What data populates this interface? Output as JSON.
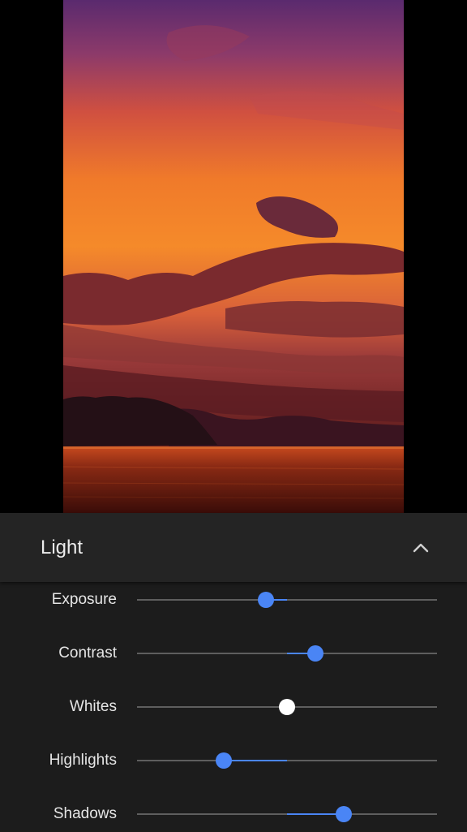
{
  "colors": {
    "accent": "#4a85f5",
    "panel_bg": "#1c1c1c",
    "header_bg": "#242424",
    "track": "#5e5e5e",
    "neutral_thumb": "#ffffff"
  },
  "panel": {
    "title": "Light",
    "collapse_icon": "chevron-up-icon"
  },
  "adjustments": [
    {
      "label": "Exposure",
      "value": -0.14,
      "neutral": false
    },
    {
      "label": "Contrast",
      "value": 0.19,
      "neutral": false
    },
    {
      "label": "Whites",
      "value": 0.0,
      "neutral": true
    },
    {
      "label": "Highlights",
      "value": -0.42,
      "neutral": false
    },
    {
      "label": "Shadows",
      "value": 0.38,
      "neutral": false
    }
  ]
}
